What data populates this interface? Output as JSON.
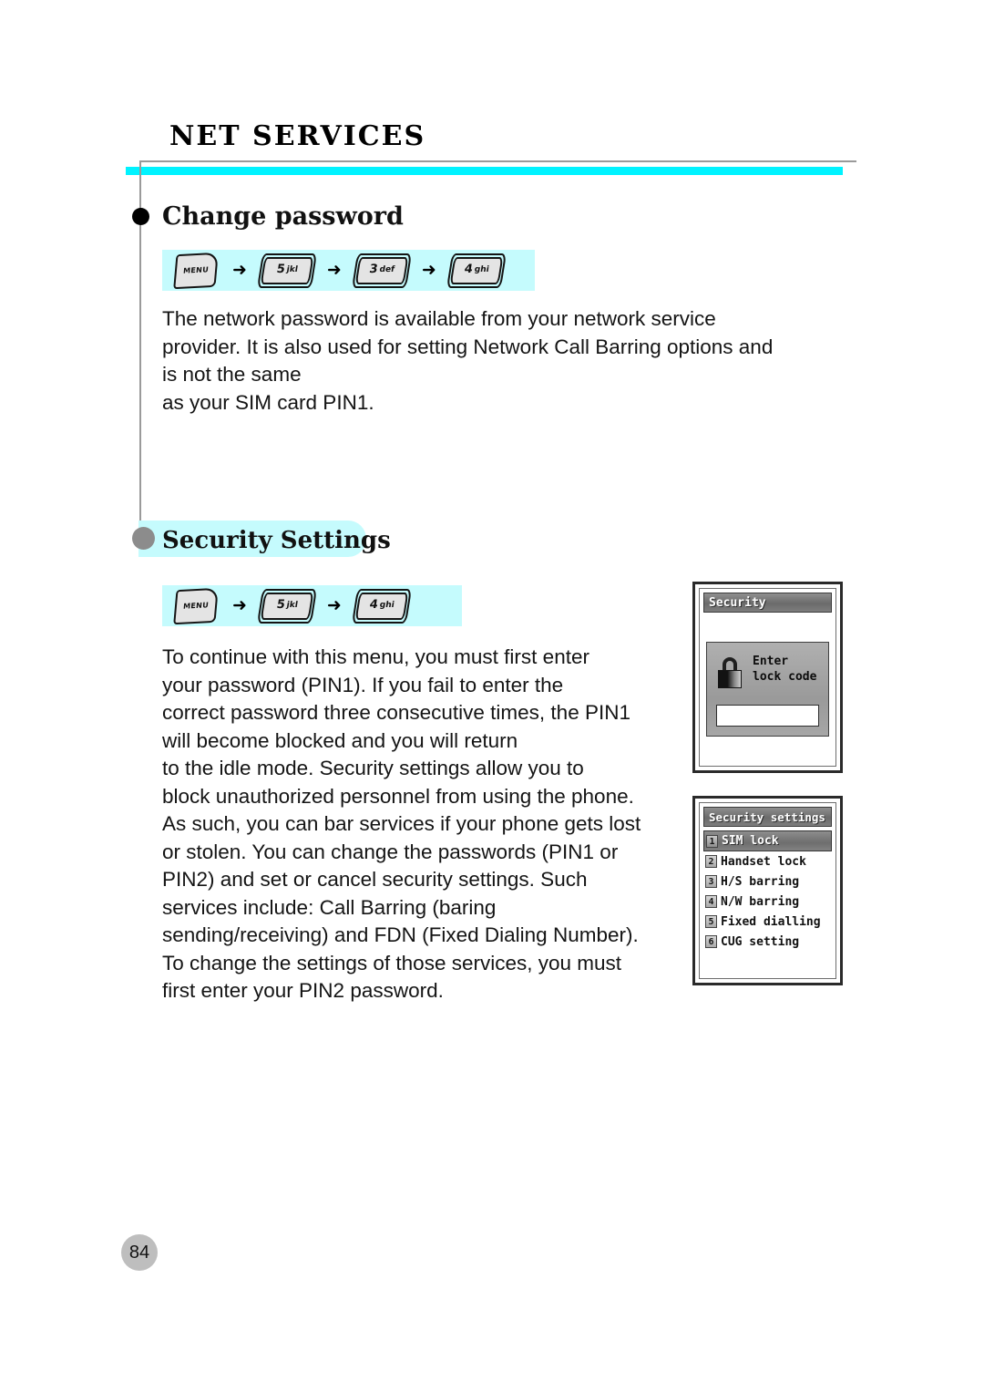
{
  "document": {
    "chapter_title": "NET SERVICES",
    "page_number": "84"
  },
  "colors": {
    "accent_cyan": "#00f3ff",
    "pill_cyan": "#c5fbfd",
    "rule_gray": "#9a9a9a",
    "bullet_black": "#000000",
    "bullet_gray": "#8c8c8c",
    "page_badge_gray": "#bebebe"
  },
  "sections": [
    {
      "id": "change-password",
      "heading": "Change password",
      "bullet_style": "black",
      "key_sequence": [
        {
          "type": "menu",
          "label": "MENU"
        },
        {
          "type": "arrow",
          "label": "➜"
        },
        {
          "type": "number",
          "digit": "5",
          "letters": "jkl"
        },
        {
          "type": "arrow",
          "label": "➜"
        },
        {
          "type": "number",
          "digit": "3",
          "letters": "def"
        },
        {
          "type": "arrow",
          "label": "➜"
        },
        {
          "type": "number",
          "digit": "4",
          "letters": "ghi"
        }
      ],
      "body": "The network password is available from your network service\nprovider. It is also used for setting Network Call Barring options and\nis not the same\nas your SIM card PIN1."
    },
    {
      "id": "security-settings",
      "heading": "Security Settings",
      "bullet_style": "gray",
      "key_sequence": [
        {
          "type": "menu",
          "label": "MENU"
        },
        {
          "type": "arrow",
          "label": "➜"
        },
        {
          "type": "number",
          "digit": "5",
          "letters": "jkl"
        },
        {
          "type": "arrow",
          "label": "➜"
        },
        {
          "type": "number",
          "digit": "4",
          "letters": "ghi"
        }
      ],
      "body": "To continue with this menu, you must first enter\nyour password (PIN1). If you fail to enter the\ncorrect password three consecutive times, the PIN1\nwill become blocked and you will return\nto the idle mode. Security settings allow you to\nblock unauthorized personnel from using the phone.\nAs such, you can bar services if your phone gets lost\nor stolen. You can change the passwords (PIN1 or\nPIN2) and set or cancel security settings. Such\nservices include: Call Barring (baring\nsending/receiving) and FDN (Fixed Dialing Number).\nTo change the settings of those services, you must\nfirst enter your PIN2 password."
    }
  ],
  "phone_screens": [
    {
      "id": "security-lock-code",
      "title": "Security",
      "dialog": {
        "icon": "padlock-icon",
        "text": "Enter\nlock code",
        "input_value": ""
      }
    },
    {
      "id": "security-settings-menu",
      "title": "Security settings",
      "items": [
        {
          "number": "1",
          "label": "SIM lock",
          "selected": true
        },
        {
          "number": "2",
          "label": "Handset lock",
          "selected": false
        },
        {
          "number": "3",
          "label": "H/S barring",
          "selected": false
        },
        {
          "number": "4",
          "label": "N/W barring",
          "selected": false
        },
        {
          "number": "5",
          "label": "Fixed dialling",
          "selected": false
        },
        {
          "number": "6",
          "label": "CUG setting",
          "selected": false
        }
      ]
    }
  ]
}
